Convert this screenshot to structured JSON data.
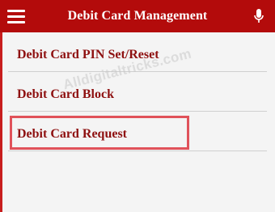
{
  "header": {
    "title": "Debit Card Management",
    "background_color": "#b30b0b",
    "menu_icon": "hamburger-menu-icon",
    "mic_icon": "microphone-icon"
  },
  "menu": {
    "items": [
      {
        "label": "Debit Card PIN Set/Reset"
      },
      {
        "label": "Debit Card Block"
      },
      {
        "label": "Debit Card Request",
        "highlighted": true
      }
    ],
    "text_color": "#8e1010",
    "highlight_color": "#e0525a"
  },
  "watermark": "Alldigitaltricks.com"
}
